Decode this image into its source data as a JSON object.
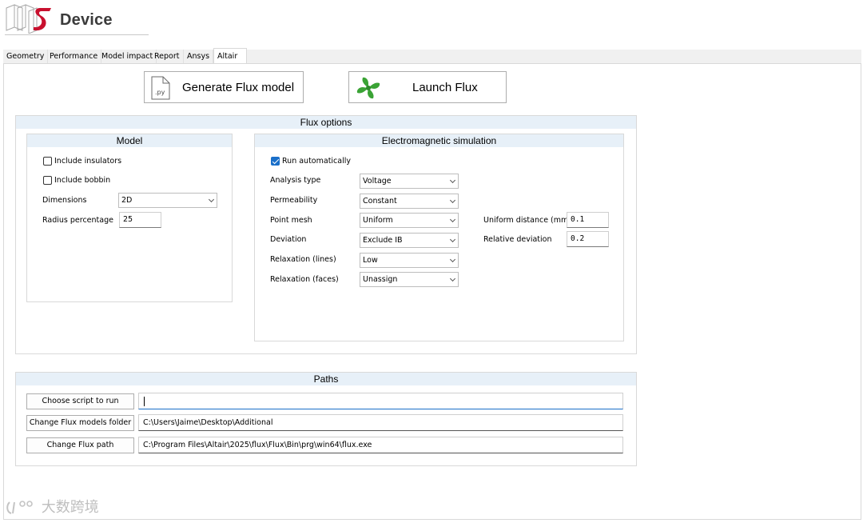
{
  "app": {
    "title": "Device"
  },
  "tabs": [
    {
      "label": "Geometry"
    },
    {
      "label": "Performance"
    },
    {
      "label": "Model impact"
    },
    {
      "label": "Report"
    },
    {
      "label": "Ansys"
    },
    {
      "label": "Altair"
    }
  ],
  "actions": {
    "generate_label": "Generate Flux model",
    "generate_icon_text": ".py",
    "launch_label": "Launch Flux"
  },
  "flux_options": {
    "title": "Flux options",
    "model": {
      "title": "Model",
      "include_insulators": {
        "label": "Include insulators",
        "checked": false
      },
      "include_bobbin": {
        "label": "Include bobbin",
        "checked": false
      },
      "dimensions": {
        "label": "Dimensions",
        "value": "2D"
      },
      "radius_percentage": {
        "label": "Radius percentage",
        "value": "25"
      }
    },
    "em": {
      "title": "Electromagnetic simulation",
      "run_automatically": {
        "label": "Run automatically",
        "checked": true
      },
      "analysis_type": {
        "label": "Analysis type",
        "value": "Voltage"
      },
      "permeability": {
        "label": "Permeability",
        "value": "Constant"
      },
      "point_mesh": {
        "label": "Point mesh",
        "value": "Uniform"
      },
      "deviation": {
        "label": "Deviation",
        "value": "Exclude IB"
      },
      "relaxation_lines": {
        "label": "Relaxation (lines)",
        "value": "Low"
      },
      "relaxation_faces": {
        "label": "Relaxation (faces)",
        "value": "Unassign"
      },
      "uniform_distance": {
        "label": "Uniform distance (mm)",
        "value": "0.1"
      },
      "relative_deviation": {
        "label": "Relative deviation",
        "value": "0.2"
      }
    }
  },
  "paths": {
    "title": "Paths",
    "script": {
      "button": "Choose script to run",
      "value": ""
    },
    "models_folder": {
      "button": "Change Flux models folder",
      "value": "C:\\Users\\Jaime\\Desktop\\Additional"
    },
    "flux_path": {
      "button": "Change Flux path",
      "value": "C:\\Program Files\\Altair\\2025\\flux\\Flux\\Bin\\prg\\win64\\flux.exe"
    }
  },
  "watermark": "大数跨境",
  "colors": {
    "group_header": "#e7f0f8",
    "checkbox_checked": "#1a6fc9",
    "logo_red": "#c8102e",
    "flux_green": "#3aa335"
  },
  "icons": {
    "logo": "mts-logo",
    "generate": "python-file-icon",
    "launch": "flux-icon"
  }
}
